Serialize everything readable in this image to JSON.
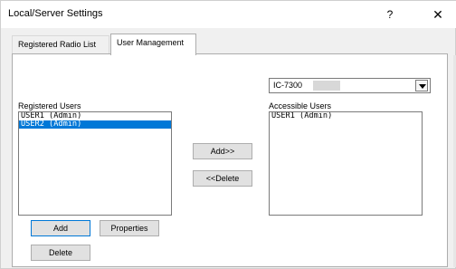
{
  "window": {
    "title": "Local/Server Settings",
    "help_label": "?",
    "close_label": "✕"
  },
  "tabs": [
    {
      "label": "Registered Radio List",
      "active": false
    },
    {
      "label": "User Management",
      "active": true
    }
  ],
  "radio_select": {
    "value": "IC-7300"
  },
  "registered_users": {
    "label": "Registered Users",
    "items": [
      "USER1 (Admin)",
      "USER2 (Admin)"
    ],
    "selected_index": 1
  },
  "accessible_users": {
    "label": "Accessible Users",
    "items": [
      "USER1 (Admin)"
    ]
  },
  "buttons": {
    "add_to": "Add>>",
    "delete_from": "<<Delete",
    "add": "Add",
    "properties": "Properties",
    "delete": "Delete"
  }
}
